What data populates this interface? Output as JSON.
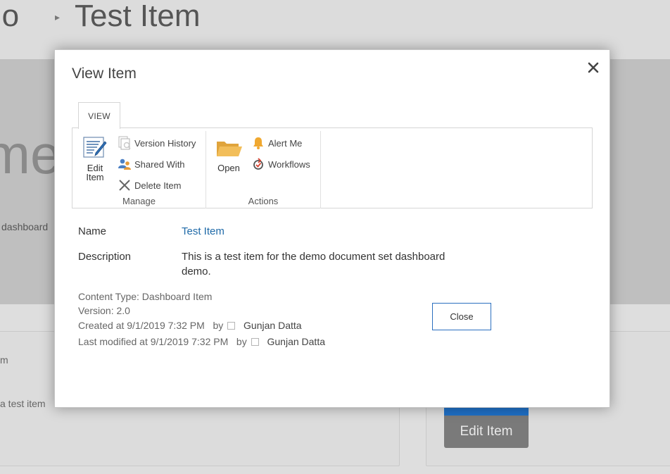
{
  "background": {
    "breadcrumb": {
      "left": "mo",
      "current": "Test Item"
    },
    "hero_partial": "me",
    "hero_sub": "dashboard",
    "card_text1": "m",
    "card_text2": "a test item",
    "edit_button": "Edit Item"
  },
  "dialog": {
    "title": "View Item",
    "ribbon": {
      "tab": "VIEW",
      "groups": {
        "manage": {
          "label": "Manage",
          "edit_item": "Edit\nItem",
          "version_history": "Version History",
          "shared_with": "Shared With",
          "delete_item": "Delete Item"
        },
        "actions": {
          "label": "Actions",
          "open": "Open",
          "alert_me": "Alert Me",
          "workflows": "Workflows"
        }
      }
    },
    "fields": {
      "name_label": "Name",
      "name_value": "Test Item",
      "description_label": "Description",
      "description_value": "This is a test item for the demo document set dashboard demo."
    },
    "meta": {
      "content_type": "Content Type: Dashboard Item",
      "version": "Version: 2.0",
      "created": "Created at 9/1/2019 7:32 PM",
      "created_by": "Gunjan Datta",
      "modified": "Last modified at 9/1/2019 7:32 PM",
      "modified_by": "Gunjan Datta",
      "by": "by"
    },
    "close_button": "Close"
  },
  "icons": {
    "close": "close-icon",
    "edit": "edit-item-icon",
    "version_history": "version-history-icon",
    "shared_with": "shared-with-icon",
    "delete": "delete-icon",
    "open": "folder-icon",
    "alert": "bell-icon",
    "workflows": "workflow-icon"
  },
  "colors": {
    "accent": "#1f6aa8",
    "button_border": "#2b6fbf",
    "overlay": "#bfbfbf"
  }
}
